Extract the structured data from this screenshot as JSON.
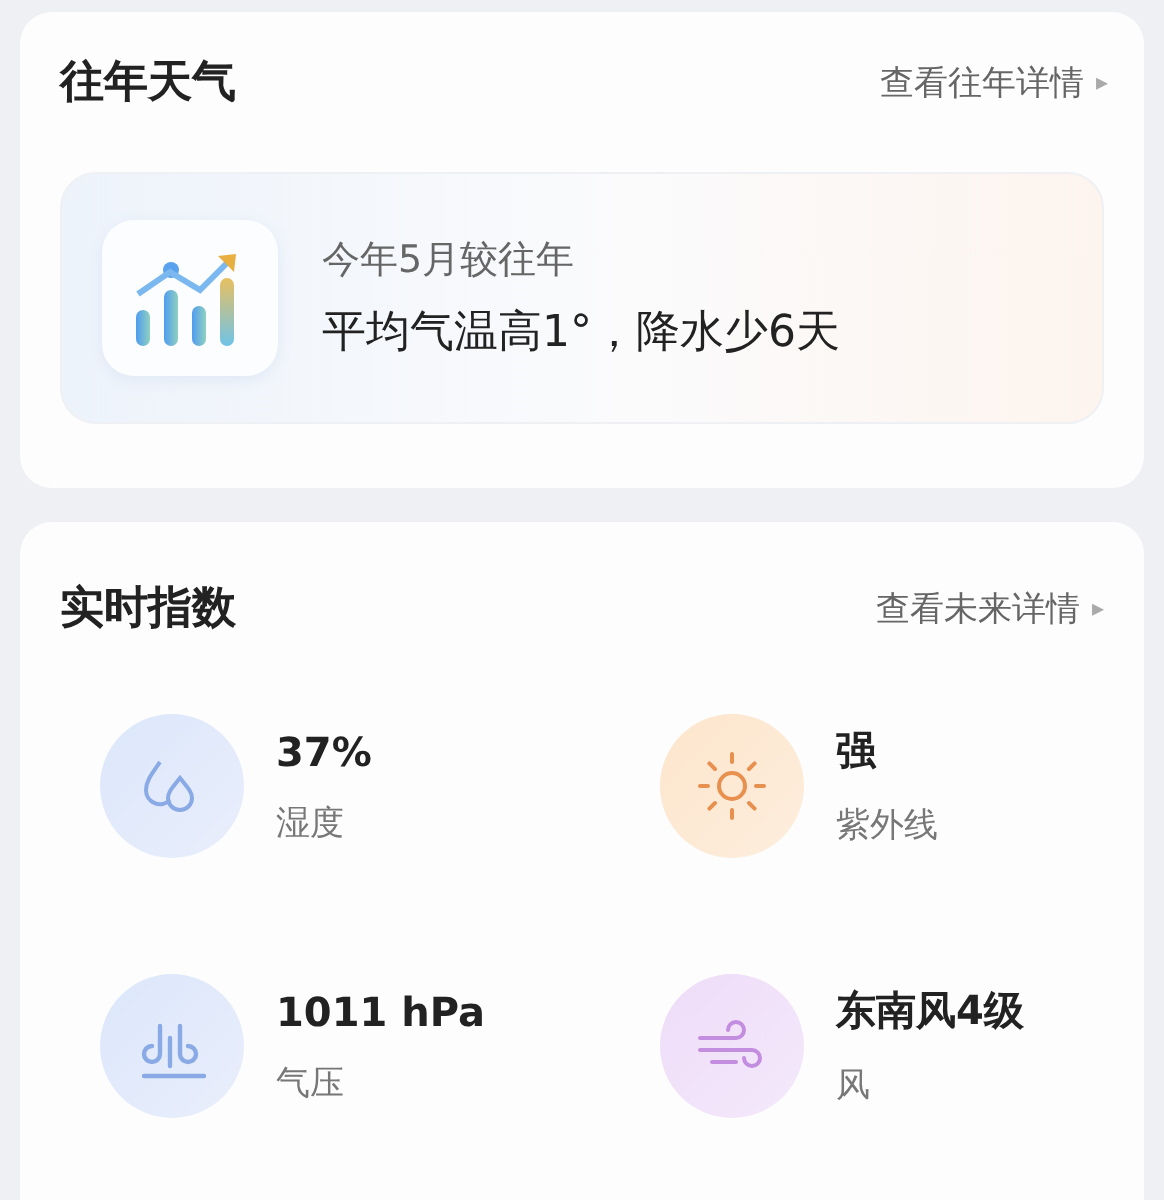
{
  "history": {
    "title": "往年天气",
    "link": "查看往年详情",
    "arrow": "▸",
    "summary": {
      "subtitle": "今年5月较往年",
      "text": "平均气温高1°，降水少6天"
    }
  },
  "realtime": {
    "title": "实时指数",
    "link": "查看未来详情",
    "arrow": "▸",
    "items": [
      {
        "kind": "humidity",
        "value": "37%",
        "label": "湿度"
      },
      {
        "kind": "uv",
        "value": "强",
        "label": "紫外线"
      },
      {
        "kind": "pressure",
        "value": "1011 hPa",
        "label": "气压"
      },
      {
        "kind": "wind",
        "value": "东南风4级",
        "label": "风"
      }
    ]
  }
}
